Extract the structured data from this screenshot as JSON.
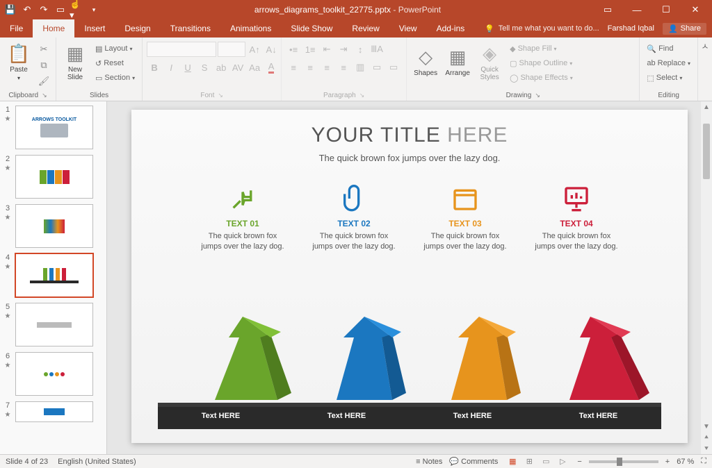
{
  "title": {
    "filename": "arrows_diagrams_toolkit_22775.pptx",
    "app": "PowerPoint"
  },
  "tabs": {
    "file": "File",
    "home": "Home",
    "insert": "Insert",
    "design": "Design",
    "transitions": "Transitions",
    "animations": "Animations",
    "slideshow": "Slide Show",
    "review": "Review",
    "view": "View",
    "addins": "Add-ins",
    "tellme": "Tell me what you want to do...",
    "user": "Farshad Iqbal",
    "share": "Share"
  },
  "ribbon": {
    "clipboard": {
      "label": "Clipboard",
      "paste": "Paste"
    },
    "slides": {
      "label": "Slides",
      "new": "New\nSlide",
      "layout": "Layout",
      "reset": "Reset",
      "section": "Section"
    },
    "font": {
      "label": "Font"
    },
    "paragraph": {
      "label": "Paragraph"
    },
    "drawing": {
      "label": "Drawing",
      "shapes": "Shapes",
      "arrange": "Arrange",
      "quick": "Quick\nStyles",
      "fill": "Shape Fill",
      "outline": "Shape Outline",
      "effects": "Shape Effects"
    },
    "editing": {
      "label": "Editing",
      "find": "Find",
      "replace": "Replace",
      "select": "Select"
    }
  },
  "slide": {
    "title_main": "YOUR TITLE",
    "title_light": "HERE",
    "subtitle": "The quick brown fox jumps over the lazy dog.",
    "cols": [
      {
        "label": "TEXT 01",
        "text": "The quick brown fox jumps over the lazy dog."
      },
      {
        "label": "TEXT 02",
        "text": "The quick brown fox jumps over the lazy dog."
      },
      {
        "label": "TEXT 03",
        "text": "The quick brown fox jumps over the lazy dog."
      },
      {
        "label": "TEXT 04",
        "text": "The quick brown fox jumps over the lazy dog."
      }
    ],
    "platform": [
      "Text HERE",
      "Text HERE",
      "Text HERE",
      "Text HERE"
    ]
  },
  "thumbs": [
    {
      "n": "1",
      "label": "ARROWS TOOLKIT"
    },
    {
      "n": "2",
      "label": ""
    },
    {
      "n": "3",
      "label": ""
    },
    {
      "n": "4",
      "label": ""
    },
    {
      "n": "5",
      "label": ""
    },
    {
      "n": "6",
      "label": ""
    },
    {
      "n": "7",
      "label": ""
    }
  ],
  "status": {
    "slide": "Slide 4 of 23",
    "lang": "English (United States)",
    "notes": "Notes",
    "comments": "Comments",
    "zoom": "67 %"
  }
}
